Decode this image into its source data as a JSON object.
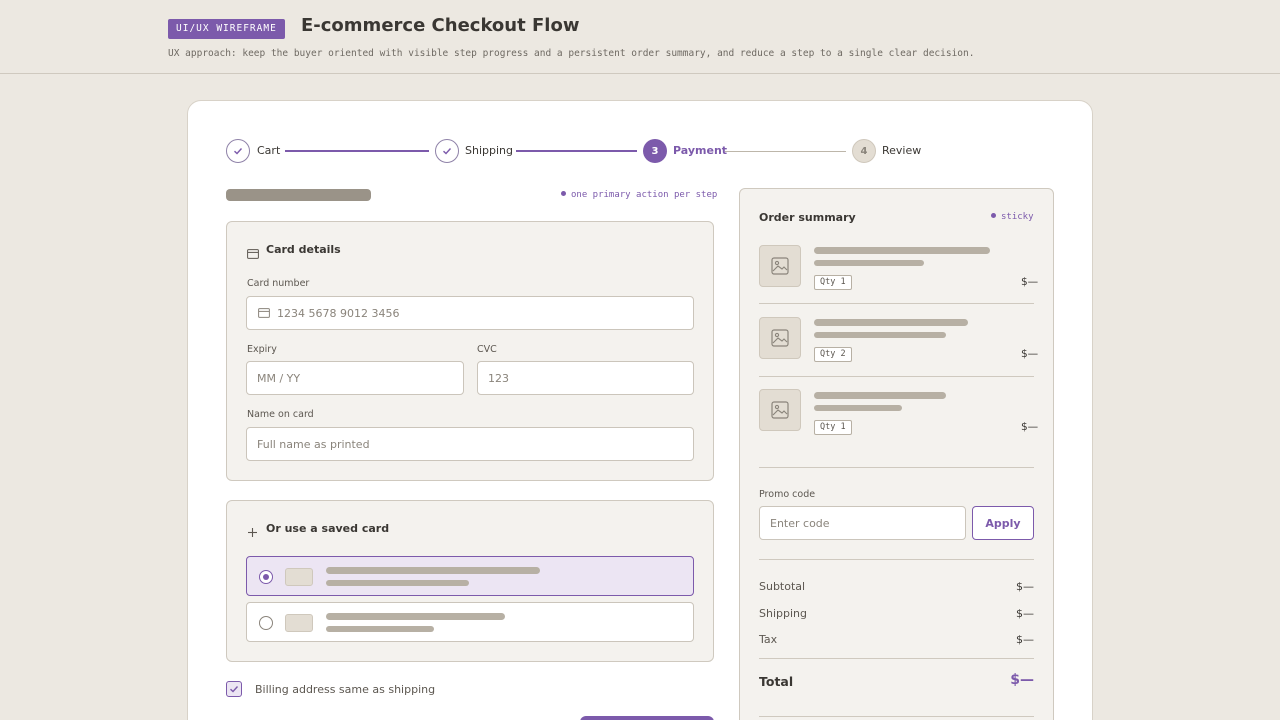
{
  "header": {
    "badge": "UI/UX WIREFRAME",
    "title": "E-commerce Checkout Flow",
    "subtitle": "UX approach: keep the buyer oriented with visible step progress and a persistent order summary, and reduce a step to a single clear decision."
  },
  "stepper": {
    "steps": [
      {
        "label": "Cart",
        "state": "done",
        "marker": "check-icon"
      },
      {
        "label": "Shipping",
        "state": "done",
        "marker": "check-icon"
      },
      {
        "label": "Payment",
        "state": "active",
        "number": "3"
      },
      {
        "label": "Review",
        "state": "todo",
        "number": "4"
      }
    ]
  },
  "hints": {
    "primary_action": "one primary action per step",
    "sticky": "sticky"
  },
  "card_details": {
    "title": "Card details",
    "icon": "credit-card-icon",
    "card_number_label": "Card number",
    "card_number_placeholder": "1234 5678 9012 3456",
    "expiry_label": "Expiry",
    "expiry_placeholder": "MM / YY",
    "cvc_label": "CVC",
    "cvc_placeholder": "123",
    "name_label": "Name on card",
    "name_placeholder": "Full name as printed"
  },
  "saved_cards": {
    "title": "Or use a saved card",
    "icon": "plus-icon",
    "selected_index": 0
  },
  "billing": {
    "label": "Billing address same as shipping",
    "checked": true
  },
  "summary": {
    "title": "Order summary",
    "items": [
      {
        "qty": "Qty 1",
        "price": "$—"
      },
      {
        "qty": "Qty 2",
        "price": "$—"
      },
      {
        "qty": "Qty 1",
        "price": "$—"
      }
    ],
    "promo_label": "Promo code",
    "promo_placeholder": "Enter code",
    "apply_label": "Apply",
    "subtotal_label": "Subtotal",
    "subtotal_value": "$—",
    "shipping_label": "Shipping",
    "shipping_value": "$—",
    "tax_label": "Tax",
    "tax_value": "$—",
    "total_label": "Total",
    "total_value": "$—"
  },
  "colors": {
    "accent": "#7c5aab",
    "background": "#ece8e1",
    "panel": "#f4f2ee",
    "placeholder_bar": "#b7b0a4"
  }
}
